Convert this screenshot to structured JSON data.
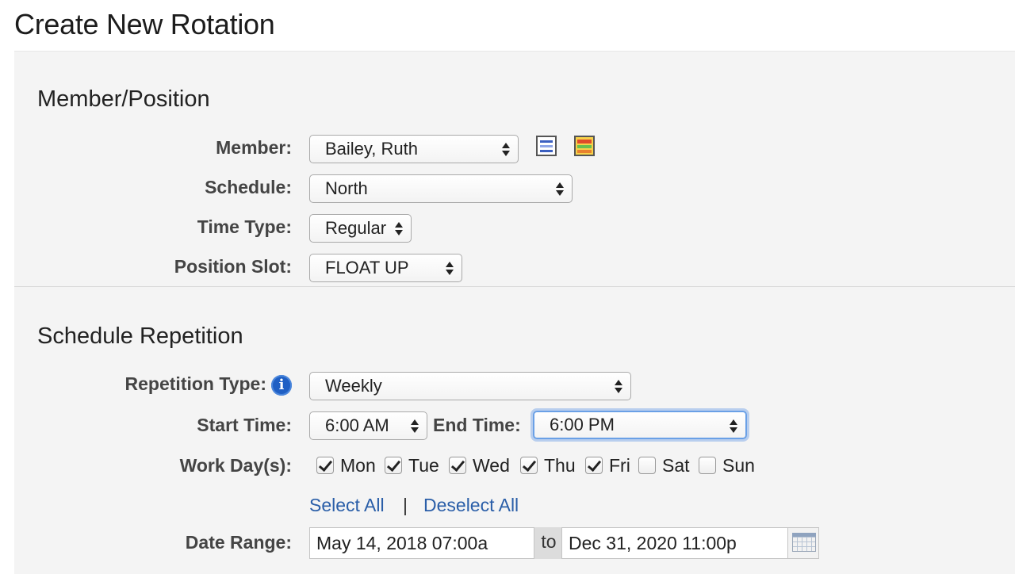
{
  "page": {
    "title": "Create New Rotation"
  },
  "member_position": {
    "section_title": "Member/Position",
    "member": {
      "label": "Member:",
      "value": "Bailey, Ruth",
      "icons": [
        "schedule-view-icon",
        "color-chart-icon"
      ]
    },
    "schedule": {
      "label": "Schedule:",
      "value": "North"
    },
    "time_type": {
      "label": "Time Type:",
      "value": "Regular"
    },
    "position_slot": {
      "label": "Position Slot:",
      "value": "FLOAT UP"
    }
  },
  "schedule_repetition": {
    "section_title": "Schedule Repetition",
    "repetition_type": {
      "label": "Repetition Type:",
      "value": "Weekly",
      "info_icon": "i"
    },
    "start_time": {
      "label": "Start Time:",
      "value": "6:00 AM"
    },
    "end_time": {
      "label": "End Time:",
      "value": "6:00 PM"
    },
    "work_days": {
      "label": "Work Day(s):",
      "days": [
        {
          "label": "Mon",
          "checked": true
        },
        {
          "label": "Tue",
          "checked": true
        },
        {
          "label": "Wed",
          "checked": true
        },
        {
          "label": "Thu",
          "checked": true
        },
        {
          "label": "Fri",
          "checked": true
        },
        {
          "label": "Sat",
          "checked": false
        },
        {
          "label": "Sun",
          "checked": false
        }
      ],
      "select_all": "Select All",
      "separator": "|",
      "deselect_all": "Deselect All"
    },
    "date_range": {
      "label": "Date Range:",
      "start": "May 14, 2018 07:00a",
      "to": "to",
      "end": "Dec 31, 2020 11:00p"
    }
  },
  "colors": {
    "link": "#2a5ea8",
    "info": "#1f5fc4",
    "focus": "#6aa0e6",
    "panel": "#f4f4f4"
  }
}
